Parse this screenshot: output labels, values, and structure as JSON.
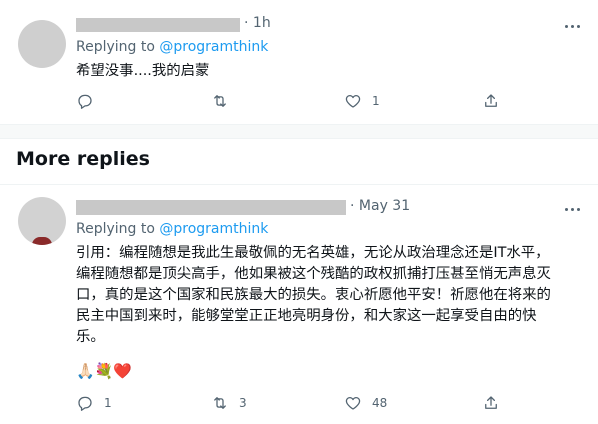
{
  "reply1": {
    "timestamp": "1h",
    "replying_prefix": "Replying to ",
    "replying_handle": "@programthink",
    "text": "希望没事....我的启蒙",
    "actions": {
      "reply_count": "",
      "retweet_count": "",
      "like_count": "1"
    }
  },
  "section": {
    "title": "More replies"
  },
  "reply2": {
    "timestamp": "May 31",
    "replying_prefix": "Replying to ",
    "replying_handle": "@programthink",
    "lines": [
      "引用：编程随想是我此生最敬佩的无名英雄，无论从政治理念还是IT水平，",
      "编程随想都是顶尖高手，他如果被这个残酷的政权抓捕打压甚至悄无声息灭",
      "口，真的是这个国家和民族最大的损失。衷心祈愿他平安！祈愿他在将来的",
      "民主中国到来时，能够堂堂正正地亮明身份，和大家这一起享受自由的快",
      "乐。"
    ],
    "emojis": [
      "🙏🏻",
      "💐",
      "❤️"
    ],
    "actions": {
      "reply_count": "1",
      "retweet_count": "3",
      "like_count": "48"
    }
  },
  "icons": [
    "reply-icon",
    "retweet-icon",
    "like-icon",
    "share-icon",
    "more-icon"
  ],
  "colors": {
    "link": "#1d9bf0",
    "secondary": "#536471",
    "heart": "#e0245e"
  }
}
